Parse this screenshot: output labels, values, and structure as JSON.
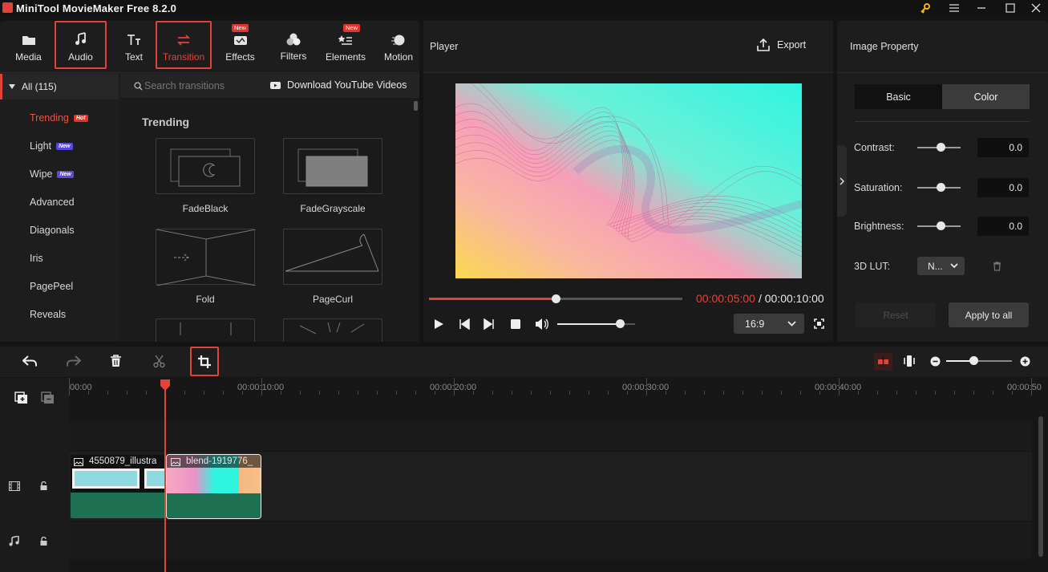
{
  "app": {
    "title": "MiniTool MovieMaker Free 8.2.0"
  },
  "toolbar": {
    "media": "Media",
    "audio": "Audio",
    "text": "Text",
    "transition": "Transition",
    "effects": "Effects",
    "filters": "Filters",
    "elements": "Elements",
    "motion": "Motion",
    "new_badge": "New"
  },
  "categories": {
    "all": "All (115)",
    "items": [
      {
        "label": "Trending",
        "tag": "Hot"
      },
      {
        "label": "Light",
        "tag": "New"
      },
      {
        "label": "Wipe",
        "tag": "New"
      },
      {
        "label": "Advanced",
        "tag": ""
      },
      {
        "label": "Diagonals",
        "tag": ""
      },
      {
        "label": "Iris",
        "tag": ""
      },
      {
        "label": "PagePeel",
        "tag": ""
      },
      {
        "label": "Reveals",
        "tag": ""
      }
    ]
  },
  "transitions": {
    "search_placeholder": "Search transitions",
    "download_label": "Download YouTube Videos",
    "section_title": "Trending",
    "items": [
      "FadeBlack",
      "FadeGrayscale",
      "Fold",
      "PageCurl"
    ]
  },
  "player": {
    "title": "Player",
    "export_label": "Export",
    "current_time": "00:00:05:00",
    "total_time": "/ 00:00:10:00",
    "progress": 0.5,
    "volume": 0.8,
    "aspect_ratio": "16:9"
  },
  "properties": {
    "title": "Image Property",
    "tab_basic": "Basic",
    "tab_color": "Color",
    "contrast_label": "Contrast:",
    "contrast_value": "0.0",
    "saturation_label": "Saturation:",
    "saturation_value": "0.0",
    "brightness_label": "Brightness:",
    "brightness_value": "0.0",
    "lut_label": "3D LUT:",
    "lut_value": "N...",
    "reset_label": "Reset",
    "apply_label": "Apply to all"
  },
  "timeline": {
    "ticks": [
      "00:00",
      "00:00:10:00",
      "00:00:20:00",
      "00:00:30:00",
      "00:00:40:00",
      "00:00:50"
    ],
    "clip1_name": "4550879_illustra",
    "clip2_name": "blend-1919776_"
  },
  "colors": {
    "accent": "#e1433a",
    "clip_green": "#1e7052",
    "preview_cyan": "#2ff5e0",
    "preview_pink": "#f6a0b8",
    "preview_yellow": "#fbd94f"
  }
}
